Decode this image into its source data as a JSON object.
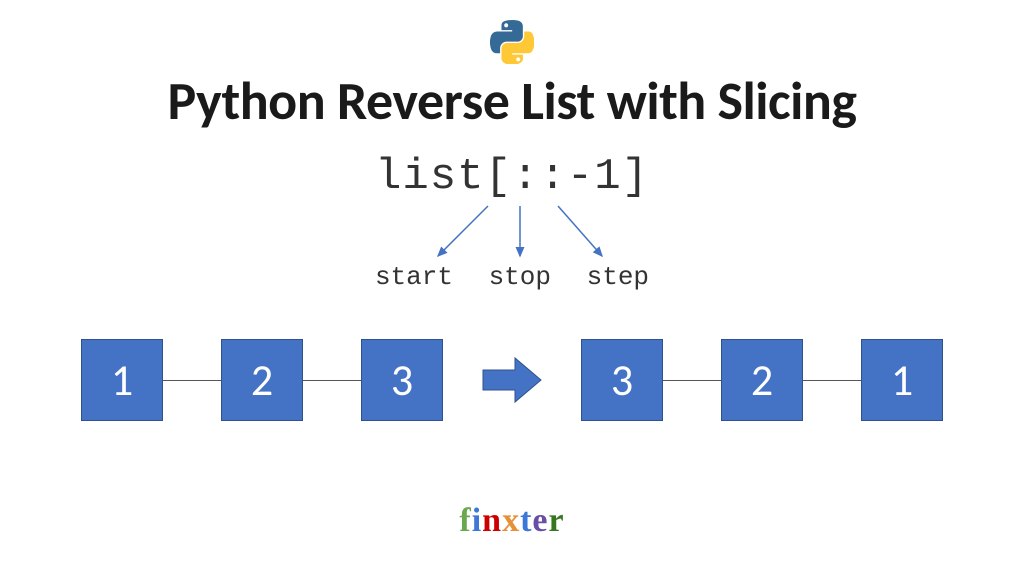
{
  "title": "Python Reverse List with Slicing",
  "code_expression": "list[::-1]",
  "slice_labels": {
    "start": "start",
    "stop": "stop",
    "step": "step"
  },
  "list_before": [
    "1",
    "2",
    "3"
  ],
  "list_after": [
    "3",
    "2",
    "1"
  ],
  "brand_letters": [
    {
      "ch": "f",
      "color": "c-green"
    },
    {
      "ch": "i",
      "color": "c-blue"
    },
    {
      "ch": "n",
      "color": "c-red"
    },
    {
      "ch": "x",
      "color": "c-orange"
    },
    {
      "ch": "t",
      "color": "c-blue"
    },
    {
      "ch": "e",
      "color": "c-purple"
    },
    {
      "ch": "r",
      "color": "c-dgreen"
    }
  ],
  "colors": {
    "box_fill": "#4472c4",
    "box_border": "#2f528f",
    "arrow_fill": "#4472c4",
    "thin_arrow": "#4472c4"
  }
}
